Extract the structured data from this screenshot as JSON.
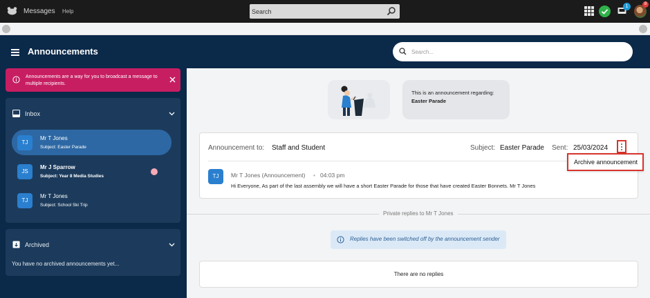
{
  "topbar": {
    "app_name": "Messages",
    "help_label": "Help",
    "search_placeholder": "Search",
    "notification_count": "1",
    "profile_badge_count": "8"
  },
  "header": {
    "title": "Announcements",
    "search_placeholder": "Search..."
  },
  "sidebar": {
    "banner_text": "Announcements are a way for you to broadcast a message to multiple recipients.",
    "inbox_label": "Inbox",
    "inbox_items": [
      {
        "initials": "TJ",
        "name": "Mr T Jones",
        "subject": "Subject: Easter Parade",
        "active": true,
        "unread": false
      },
      {
        "initials": "JS",
        "name": "Mr J Sparrow",
        "subject": "Subject: Year 8 Media Studies",
        "active": false,
        "unread": true
      },
      {
        "initials": "TJ",
        "name": "Mr T Jones",
        "subject": "Subject: School Ski Trip",
        "active": false,
        "unread": false
      }
    ],
    "archived_label": "Archived",
    "archived_empty": "You have no archived announcements yet..."
  },
  "main": {
    "regarding_line": "This is an announcement regarding:",
    "regarding_subject": "Easter Parade",
    "announcement": {
      "to_label": "Announcement to:",
      "to_value": "Staff and Student",
      "subject_label": "Subject:",
      "subject_value": "Easter Parade",
      "sent_label": "Sent:",
      "sent_value": "25/03/2024",
      "sender_initials": "TJ",
      "sender": "Mr T Jones (Announcement)",
      "separator": "•",
      "time": "04:03 pm",
      "body": "Hi Everyone, As part of the last assembly we will have a short Easter Parade for those that have created Easter Bonnets. Mr T Jones"
    },
    "menu_item": "Archive announcement",
    "private_replies_label": "Private replies to Mr T Jones",
    "replies_notice": "Replies have been switched off by the announcement sender",
    "no_replies": "There are no replies"
  },
  "colors": {
    "topbar": "#1b1b1b",
    "navy": "#0b2949",
    "panel": "#1c3b5c",
    "active_item": "#2d68a4",
    "banner": "#c71e62",
    "highlight": "#d8332b",
    "status_green": "#30b14a"
  }
}
